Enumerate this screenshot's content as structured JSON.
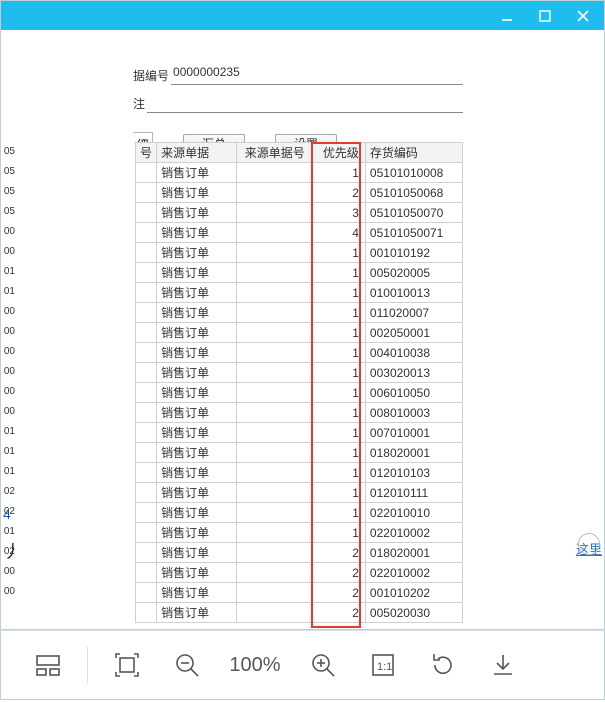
{
  "window": {
    "minimize": "minimize",
    "maximize": "maximize",
    "close": "close",
    "more": "···"
  },
  "form": {
    "doc_no_label": "据编号",
    "doc_no_value": "0000000235",
    "remark_label": "注"
  },
  "tabs": {
    "detail": "细",
    "summary": "汇总",
    "settings": "设置"
  },
  "table": {
    "headers": {
      "seq": "号",
      "source_doc": "来源单据",
      "source_no": "来源单据号",
      "priority": "优先级",
      "inventory": "存货编码"
    },
    "rows": [
      {
        "src": "销售订单",
        "srcno": "",
        "pri": 1,
        "inv": "05101010008"
      },
      {
        "src": "销售订单",
        "srcno": "",
        "pri": 2,
        "inv": "05101050068"
      },
      {
        "src": "销售订单",
        "srcno": "",
        "pri": 3,
        "inv": "05101050070"
      },
      {
        "src": "销售订单",
        "srcno": "",
        "pri": 4,
        "inv": "05101050071"
      },
      {
        "src": "销售订单",
        "srcno": "",
        "pri": 1,
        "inv": "001010192"
      },
      {
        "src": "销售订单",
        "srcno": "",
        "pri": 1,
        "inv": "005020005"
      },
      {
        "src": "销售订单",
        "srcno": "",
        "pri": 1,
        "inv": "010010013"
      },
      {
        "src": "销售订单",
        "srcno": "",
        "pri": 1,
        "inv": "011020007"
      },
      {
        "src": "销售订单",
        "srcno": "",
        "pri": 1,
        "inv": "002050001"
      },
      {
        "src": "销售订单",
        "srcno": "",
        "pri": 1,
        "inv": "004010038"
      },
      {
        "src": "销售订单",
        "srcno": "",
        "pri": 1,
        "inv": "003020013"
      },
      {
        "src": "销售订单",
        "srcno": "",
        "pri": 1,
        "inv": "006010050"
      },
      {
        "src": "销售订单",
        "srcno": "",
        "pri": 1,
        "inv": "008010003"
      },
      {
        "src": "销售订单",
        "srcno": "",
        "pri": 1,
        "inv": "007010001"
      },
      {
        "src": "销售订单",
        "srcno": "",
        "pri": 1,
        "inv": "018020001"
      },
      {
        "src": "销售订单",
        "srcno": "",
        "pri": 1,
        "inv": "012010103"
      },
      {
        "src": "销售订单",
        "srcno": "",
        "pri": 1,
        "inv": "012010111"
      },
      {
        "src": "销售订单",
        "srcno": "",
        "pri": 1,
        "inv": "022010010"
      },
      {
        "src": "销售订单",
        "srcno": "",
        "pri": 1,
        "inv": "022010002"
      },
      {
        "src": "销售订单",
        "srcno": "",
        "pri": 2,
        "inv": "018020001"
      },
      {
        "src": "销售订单",
        "srcno": "",
        "pri": 2,
        "inv": "022010002"
      },
      {
        "src": "销售订单",
        "srcno": "",
        "pri": 2,
        "inv": "001010202"
      },
      {
        "src": "销售订单",
        "srcno": "",
        "pri": 2,
        "inv": "005020030"
      }
    ]
  },
  "side_codes": [
    "05",
    "05",
    "05",
    "05",
    "00",
    "00",
    "01",
    "01",
    "00",
    "00",
    "00",
    "00",
    "00",
    "00",
    "01",
    "01",
    "01",
    "02",
    "02",
    "01",
    "02",
    "00",
    "00"
  ],
  "side_link": "4",
  "side_char": "丿",
  "right_hint": "这里",
  "zoom": "100%"
}
